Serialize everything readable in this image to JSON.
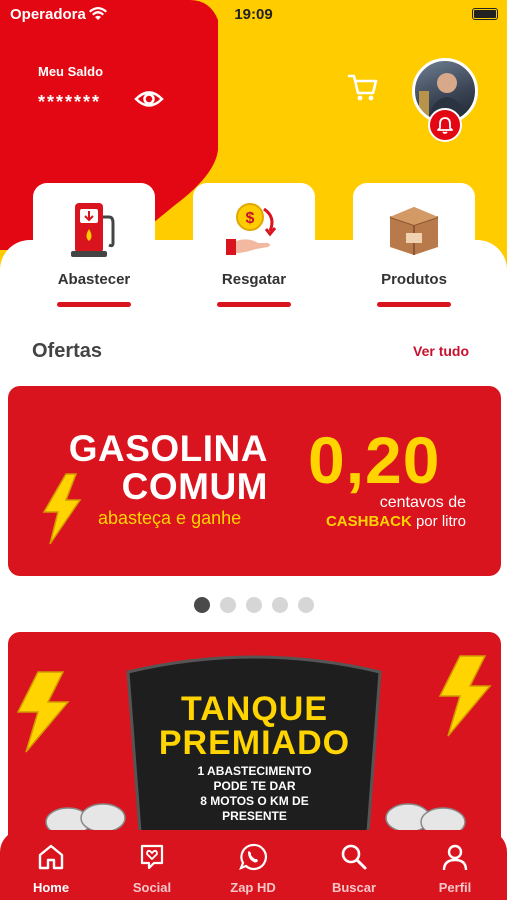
{
  "status_bar": {
    "carrier": "Operadora",
    "time": "19:09"
  },
  "balance": {
    "label": "Meu Saldo",
    "masked_value": "*******"
  },
  "icons": {
    "wifi": "wifi-icon",
    "battery": "battery-icon",
    "visibility": "eye-icon",
    "cart": "cart-icon",
    "notifications": "bell-icon"
  },
  "actions": [
    {
      "label": "Abastecer",
      "icon": "fuel-pump-icon"
    },
    {
      "label": "Resgatar",
      "icon": "redeem-coin-icon"
    },
    {
      "label": "Produtos",
      "icon": "box-icon"
    }
  ],
  "offers": {
    "title": "Ofertas",
    "see_all": "Ver tudo",
    "banner1": {
      "line1": "GASOLINA",
      "line2": "COMUM",
      "subtitle": "abasteça e ganhe",
      "value": "0,20",
      "cents_text": "centavos de",
      "cashback": "CASHBACK",
      "per_liter": "por litro"
    },
    "carousel_pages": 5,
    "carousel_active_index": 0,
    "banner2": {
      "title1": "TANQUE",
      "title2": "PREMIADO",
      "line1": "1 ABASTECIMENTO",
      "line2": "PODE TE DAR",
      "line3": "8 MOTOS O KM DE",
      "line4": "PRESENTE"
    }
  },
  "tabs": [
    {
      "label": "Home",
      "icon": "home-icon",
      "active": true
    },
    {
      "label": "Social",
      "icon": "social-heart-icon",
      "active": false
    },
    {
      "label": "Zap HD",
      "icon": "whatsapp-icon",
      "active": false
    },
    {
      "label": "Buscar",
      "icon": "search-icon",
      "active": false
    },
    {
      "label": "Perfil",
      "icon": "user-icon",
      "active": false
    }
  ],
  "colors": {
    "primary_red": "#d9141e",
    "accent_yellow": "#ffcc00",
    "banner_yellow": "#ffd400"
  }
}
